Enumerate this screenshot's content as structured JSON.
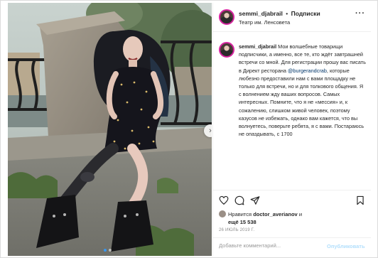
{
  "header": {
    "username": "semmi_djabrail",
    "separator": "•",
    "follow_label": "Подписки",
    "location": "Театр им. Ленсовета",
    "more_label": "···"
  },
  "caption": {
    "username": "semmi_djabrail",
    "text_before_mention": "Мои волшебные товарищи подписчики, а именно, все те, кто ждёт завтрашней встречи со мной. Для регистрации прошу вас писать в Директ ресторана",
    "mention": "@burgerandcrab",
    "text_after_mention": ", которые любезно предоставили нам с вами площадку не только для встречи, но и для толкового общения. Я с волнением жду ваших вопросов. Самых интересных. Помните, что я не «мессия» и, к сожалению, слишком живой человек, поэтому казусов не избежать, однако вам кажется, что вы волнуетесь, поверьте ребята, я с вами. Постараюсь не опаздывать, с 1700"
  },
  "likes": {
    "prefix": "Нравится",
    "liker": "doctor_averianov",
    "connector": "и",
    "others": "ещё 15 538"
  },
  "date": "26 ИЮЛЬ 2019 Г.",
  "add_comment": {
    "placeholder": "Добавьте комментарий...",
    "post_label": "Опубликовать"
  },
  "photo": {
    "next_label": "›"
  },
  "icons": {
    "like": "heart-icon",
    "comment": "comment-icon",
    "share": "share-icon",
    "save": "bookmark-icon"
  },
  "colors": {
    "accent": "#3897f0",
    "mention": "#003569",
    "muted": "#8e8e8e",
    "post_disabled": "#b2dffc",
    "story_ring": "#d6249f"
  }
}
